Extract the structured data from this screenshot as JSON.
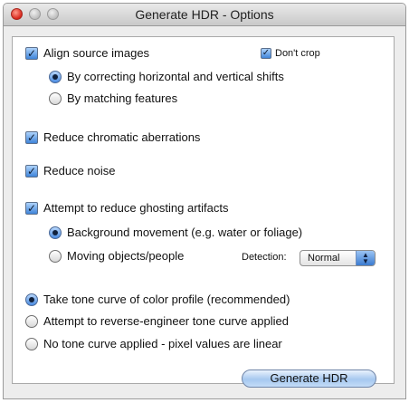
{
  "window": {
    "title": "Generate HDR - Options"
  },
  "options": {
    "align": {
      "label": "Align source images",
      "checked": true
    },
    "dont_crop": {
      "label": "Don't crop",
      "checked": true
    },
    "align_horizontal_vertical": {
      "label": "By correcting horizontal and vertical shifts",
      "selected": true
    },
    "align_features": {
      "label": "By matching features",
      "selected": false
    },
    "chromatic": {
      "label": "Reduce chromatic aberrations",
      "checked": true
    },
    "noise": {
      "label": "Reduce noise",
      "checked": true
    },
    "ghosting": {
      "label": "Attempt to reduce ghosting artifacts",
      "checked": true
    },
    "background_movement": {
      "label": "Background movement (e.g. water or foliage)",
      "selected": true
    },
    "moving_objects": {
      "label": "Moving objects/people",
      "selected": false
    },
    "detection": {
      "label": "Detection:",
      "value": "Normal"
    },
    "tone_profile": {
      "label": "Take tone curve of color profile   (recommended)",
      "selected": true
    },
    "tone_reverse": {
      "label": "Attempt to reverse-engineer tone curve applied",
      "selected": false
    },
    "tone_linear": {
      "label": "No tone curve applied - pixel values are linear",
      "selected": false
    }
  },
  "actions": {
    "generate_label": "Generate HDR"
  },
  "icons": {
    "check": "checkmark-icon",
    "radio": "radio-dot-icon",
    "select_arrows": "up-down-arrows-icon"
  }
}
